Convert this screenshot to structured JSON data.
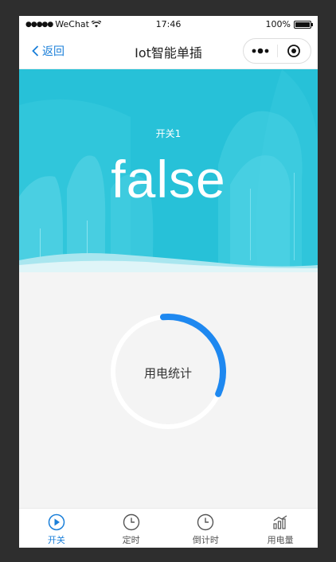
{
  "status_bar": {
    "carrier": "WeChat",
    "time": "17:46",
    "battery": "100%"
  },
  "nav": {
    "back_label": "返回",
    "title": "Iot智能单插"
  },
  "hero": {
    "switch_name": "开关1",
    "state": "false"
  },
  "usage": {
    "label": "用电统计",
    "progress": 0.33
  },
  "tabs": [
    {
      "label": "开关",
      "icon": "play-icon",
      "active": true
    },
    {
      "label": "定时",
      "icon": "clock-icon",
      "active": false
    },
    {
      "label": "倒计时",
      "icon": "timer-icon",
      "active": false
    },
    {
      "label": "用电量",
      "icon": "bar-chart-icon",
      "active": false
    }
  ],
  "colors": {
    "accent": "#1a7fd9",
    "ring": "#1e88f0",
    "hero": "#27c1d8"
  }
}
